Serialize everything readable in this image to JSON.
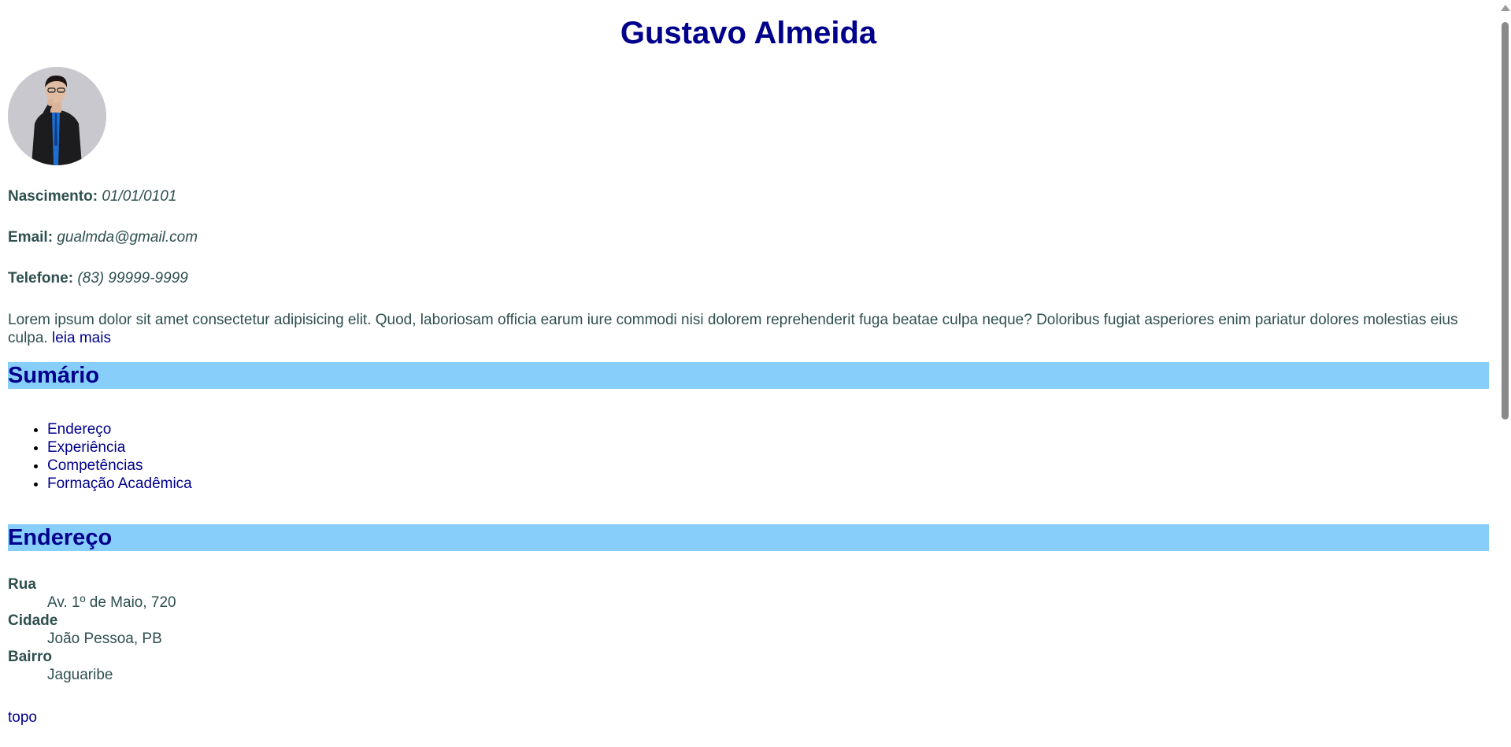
{
  "header": {
    "title": "Gustavo Almeida"
  },
  "profile": {
    "birth_label": "Nascimento:",
    "birth_value": "01/01/0101",
    "email_label": "Email:",
    "email_value": "gualmda@gmail.com",
    "phone_label": "Telefone:",
    "phone_value": "(83) 99999-9999",
    "bio": "Lorem ipsum dolor sit amet consectetur adipisicing elit. Quod, laboriosam officia earum iure commodi nisi dolorem reprehenderit fuga beatae culpa neque? Doloribus fugiat asperiores enim pariatur dolores molestias eius culpa.",
    "read_more": "leia mais"
  },
  "summary": {
    "heading": "Sumário",
    "items": [
      "Endereço",
      "Experiência",
      "Competências",
      "Formação Acadêmica"
    ]
  },
  "address": {
    "heading": "Endereço",
    "street_label": "Rua",
    "street_value": "Av. 1º de Maio, 720",
    "city_label": "Cidade",
    "city_value": "João Pessoa, PB",
    "district_label": "Bairro",
    "district_value": "Jaguaribe"
  },
  "footer": {
    "top_link": "topo"
  },
  "colors": {
    "title": "#00008b",
    "link": "#00008b",
    "section_bg": "#87cefa",
    "text": "#2f4f4f"
  }
}
